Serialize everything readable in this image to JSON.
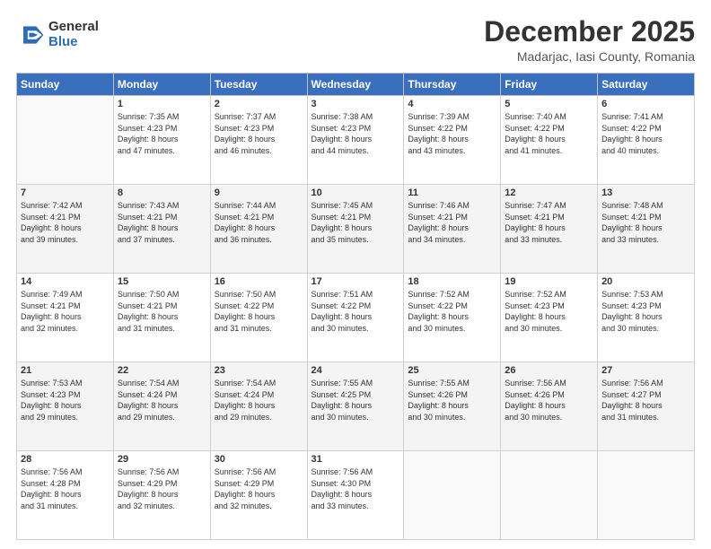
{
  "header": {
    "logo_general": "General",
    "logo_blue": "Blue",
    "title": "December 2025",
    "subtitle": "Madarjac, Iasi County, Romania"
  },
  "calendar": {
    "days_of_week": [
      "Sunday",
      "Monday",
      "Tuesday",
      "Wednesday",
      "Thursday",
      "Friday",
      "Saturday"
    ],
    "weeks": [
      [
        {
          "day": "",
          "info": ""
        },
        {
          "day": "1",
          "info": "Sunrise: 7:35 AM\nSunset: 4:23 PM\nDaylight: 8 hours\nand 47 minutes."
        },
        {
          "day": "2",
          "info": "Sunrise: 7:37 AM\nSunset: 4:23 PM\nDaylight: 8 hours\nand 46 minutes."
        },
        {
          "day": "3",
          "info": "Sunrise: 7:38 AM\nSunset: 4:23 PM\nDaylight: 8 hours\nand 44 minutes."
        },
        {
          "day": "4",
          "info": "Sunrise: 7:39 AM\nSunset: 4:22 PM\nDaylight: 8 hours\nand 43 minutes."
        },
        {
          "day": "5",
          "info": "Sunrise: 7:40 AM\nSunset: 4:22 PM\nDaylight: 8 hours\nand 41 minutes."
        },
        {
          "day": "6",
          "info": "Sunrise: 7:41 AM\nSunset: 4:22 PM\nDaylight: 8 hours\nand 40 minutes."
        }
      ],
      [
        {
          "day": "7",
          "info": "Sunrise: 7:42 AM\nSunset: 4:21 PM\nDaylight: 8 hours\nand 39 minutes."
        },
        {
          "day": "8",
          "info": "Sunrise: 7:43 AM\nSunset: 4:21 PM\nDaylight: 8 hours\nand 37 minutes."
        },
        {
          "day": "9",
          "info": "Sunrise: 7:44 AM\nSunset: 4:21 PM\nDaylight: 8 hours\nand 36 minutes."
        },
        {
          "day": "10",
          "info": "Sunrise: 7:45 AM\nSunset: 4:21 PM\nDaylight: 8 hours\nand 35 minutes."
        },
        {
          "day": "11",
          "info": "Sunrise: 7:46 AM\nSunset: 4:21 PM\nDaylight: 8 hours\nand 34 minutes."
        },
        {
          "day": "12",
          "info": "Sunrise: 7:47 AM\nSunset: 4:21 PM\nDaylight: 8 hours\nand 33 minutes."
        },
        {
          "day": "13",
          "info": "Sunrise: 7:48 AM\nSunset: 4:21 PM\nDaylight: 8 hours\nand 33 minutes."
        }
      ],
      [
        {
          "day": "14",
          "info": "Sunrise: 7:49 AM\nSunset: 4:21 PM\nDaylight: 8 hours\nand 32 minutes."
        },
        {
          "day": "15",
          "info": "Sunrise: 7:50 AM\nSunset: 4:21 PM\nDaylight: 8 hours\nand 31 minutes."
        },
        {
          "day": "16",
          "info": "Sunrise: 7:50 AM\nSunset: 4:22 PM\nDaylight: 8 hours\nand 31 minutes."
        },
        {
          "day": "17",
          "info": "Sunrise: 7:51 AM\nSunset: 4:22 PM\nDaylight: 8 hours\nand 30 minutes."
        },
        {
          "day": "18",
          "info": "Sunrise: 7:52 AM\nSunset: 4:22 PM\nDaylight: 8 hours\nand 30 minutes."
        },
        {
          "day": "19",
          "info": "Sunrise: 7:52 AM\nSunset: 4:23 PM\nDaylight: 8 hours\nand 30 minutes."
        },
        {
          "day": "20",
          "info": "Sunrise: 7:53 AM\nSunset: 4:23 PM\nDaylight: 8 hours\nand 30 minutes."
        }
      ],
      [
        {
          "day": "21",
          "info": "Sunrise: 7:53 AM\nSunset: 4:23 PM\nDaylight: 8 hours\nand 29 minutes."
        },
        {
          "day": "22",
          "info": "Sunrise: 7:54 AM\nSunset: 4:24 PM\nDaylight: 8 hours\nand 29 minutes."
        },
        {
          "day": "23",
          "info": "Sunrise: 7:54 AM\nSunset: 4:24 PM\nDaylight: 8 hours\nand 29 minutes."
        },
        {
          "day": "24",
          "info": "Sunrise: 7:55 AM\nSunset: 4:25 PM\nDaylight: 8 hours\nand 30 minutes."
        },
        {
          "day": "25",
          "info": "Sunrise: 7:55 AM\nSunset: 4:26 PM\nDaylight: 8 hours\nand 30 minutes."
        },
        {
          "day": "26",
          "info": "Sunrise: 7:56 AM\nSunset: 4:26 PM\nDaylight: 8 hours\nand 30 minutes."
        },
        {
          "day": "27",
          "info": "Sunrise: 7:56 AM\nSunset: 4:27 PM\nDaylight: 8 hours\nand 31 minutes."
        }
      ],
      [
        {
          "day": "28",
          "info": "Sunrise: 7:56 AM\nSunset: 4:28 PM\nDaylight: 8 hours\nand 31 minutes."
        },
        {
          "day": "29",
          "info": "Sunrise: 7:56 AM\nSunset: 4:29 PM\nDaylight: 8 hours\nand 32 minutes."
        },
        {
          "day": "30",
          "info": "Sunrise: 7:56 AM\nSunset: 4:29 PM\nDaylight: 8 hours\nand 32 minutes."
        },
        {
          "day": "31",
          "info": "Sunrise: 7:56 AM\nSunset: 4:30 PM\nDaylight: 8 hours\nand 33 minutes."
        },
        {
          "day": "",
          "info": ""
        },
        {
          "day": "",
          "info": ""
        },
        {
          "day": "",
          "info": ""
        }
      ]
    ]
  }
}
